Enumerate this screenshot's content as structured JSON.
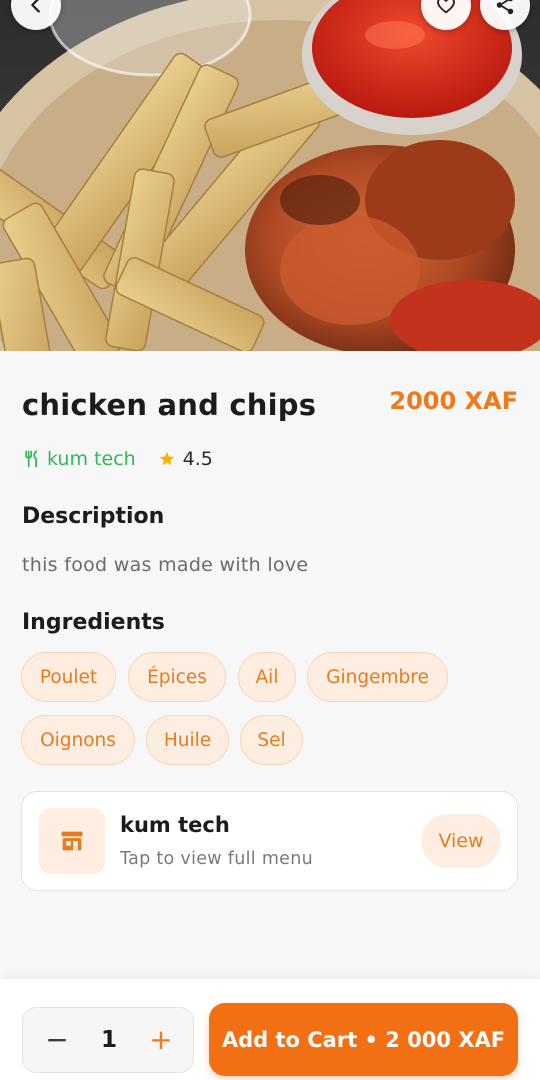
{
  "food": {
    "name": "chicken and chips",
    "price": "2000 XAF",
    "restaurant": "kum tech",
    "rating": "4.5"
  },
  "description": {
    "heading": "Description",
    "text": "this food was made with love"
  },
  "ingredients": {
    "heading": "Ingredients",
    "items": [
      "Poulet",
      "Épices",
      "Ail",
      "Gingembre",
      "Oignons",
      "Huile",
      "Sel"
    ]
  },
  "restaurant_card": {
    "name": "kum tech",
    "subtitle": "Tap to view full menu",
    "view_label": "View"
  },
  "cart": {
    "minus": "−",
    "quantity": "1",
    "plus": "+",
    "add_label": "Add to Cart • 2 000 XAF"
  },
  "colors": {
    "accent": "#f26f14",
    "restaurant_link": "#2fb85a",
    "chip_bg": "#fdeee1",
    "star": "#f5b400"
  },
  "icons": {
    "back": "arrow-left-icon",
    "favorite": "heart-icon",
    "share": "share-icon",
    "restaurant": "fork-knife-icon",
    "rating": "star-icon",
    "store": "storefront-icon"
  }
}
